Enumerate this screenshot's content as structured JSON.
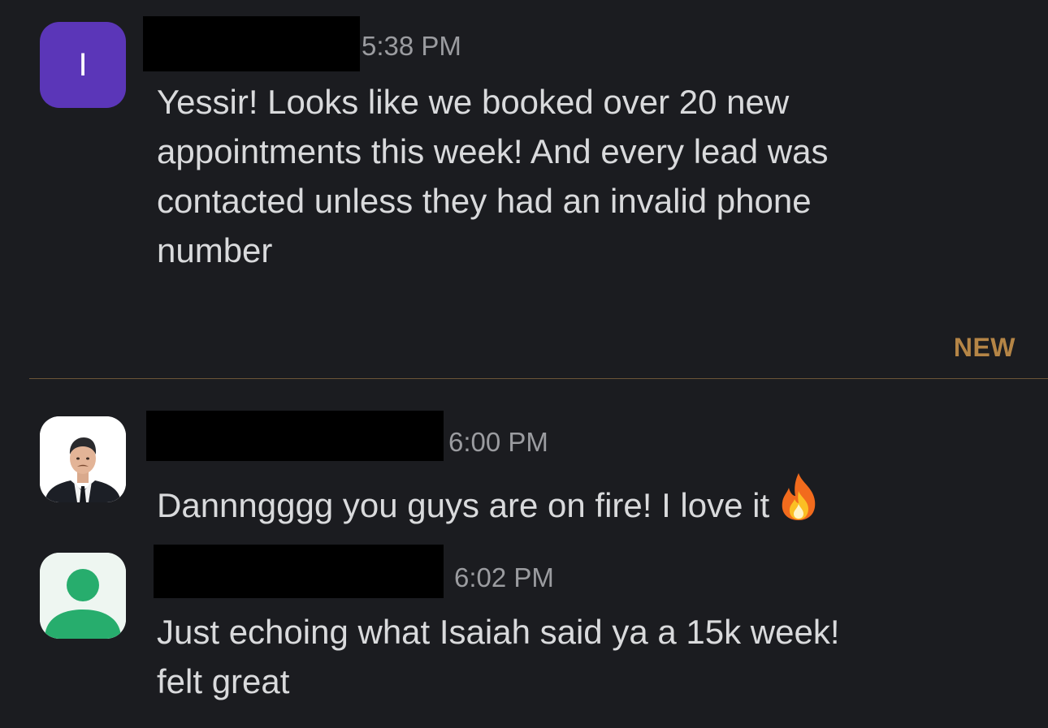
{
  "messages": [
    {
      "avatar_initial": "I",
      "time": "5:38 PM",
      "lines": [
        "Yessir! Looks like we booked over 20 new",
        "appointments this week! And every lead was",
        "contacted unless they had an invalid phone",
        "number"
      ]
    },
    {
      "time": "6:00 PM",
      "text": "Dannngggg you guys are on fire! I love it",
      "emoji": "fire-emoji"
    },
    {
      "time": "6:02 PM",
      "lines": [
        "Just echoing what Isaiah said ya a 15k week!",
        "felt great"
      ]
    }
  ],
  "new_divider": {
    "label": "NEW",
    "color": "#b58546"
  },
  "colors": {
    "background": "#1b1c20",
    "avatar_purple": "#5b36b8",
    "avatar_green": "#27ad6d"
  }
}
